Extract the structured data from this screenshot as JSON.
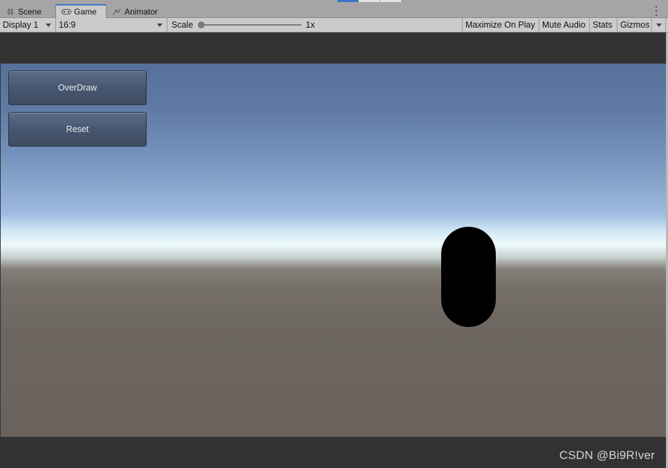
{
  "tabs": [
    {
      "label": "Scene",
      "icon": "grid-icon",
      "active": false
    },
    {
      "label": "Game",
      "icon": "gamepad-icon",
      "active": true
    },
    {
      "label": "Animator",
      "icon": "animator-icon",
      "active": false
    }
  ],
  "toolbar": {
    "display": "Display 1",
    "aspect": "16:9",
    "scale_label": "Scale",
    "scale_value": "1x",
    "maximize_on_play": "Maximize On Play",
    "mute_audio": "Mute Audio",
    "stats": "Stats",
    "gizmos": "Gizmos"
  },
  "game": {
    "overdraw_button": "OverDraw",
    "reset_button": "Reset"
  },
  "watermark": "CSDN @Bi9R!ver",
  "colors": {
    "accent": "#3a72c8",
    "button_fill": "#475770",
    "capsule": "#000000"
  }
}
